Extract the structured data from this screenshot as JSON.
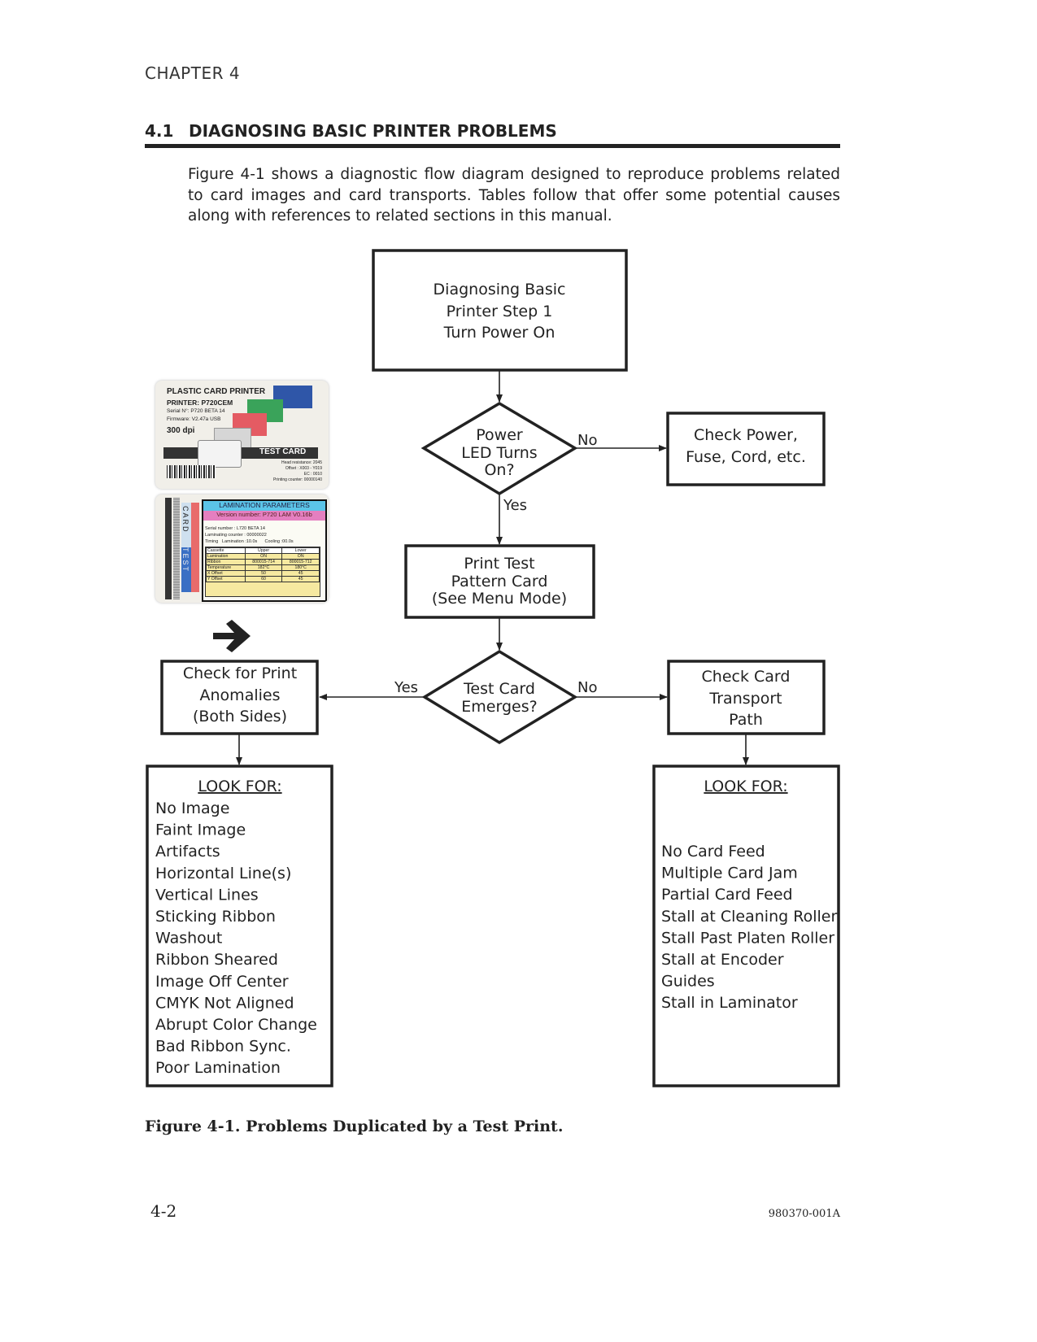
{
  "header": {
    "chapter": "CHAPTER 4"
  },
  "section": {
    "number": "4.1",
    "title": "DIAGNOSING BASIC PRINTER PROBLEMS"
  },
  "intro": "Figure 4-1 shows a diagnostic flow diagram designed to reproduce problems related to card images and card transports. Tables follow that offer some potential causes along with references to related sections in this manual.",
  "flow": {
    "start": [
      "Diagnosing Basic",
      "Printer Step 1",
      "Turn Power On"
    ],
    "decision1": [
      "Power",
      "LED Turns",
      "On?"
    ],
    "decision1_no": "No",
    "decision1_yes": "Yes",
    "check_power": [
      "Check Power,",
      "Fuse, Cord, etc."
    ],
    "print_test": [
      "Print Test",
      "Pattern Card",
      "(See Menu Mode)"
    ],
    "decision2": [
      "Test Card",
      "Emerges?"
    ],
    "decision2_yes": "Yes",
    "decision2_no": "No",
    "check_print": [
      "Check for Print",
      "Anomalies",
      "(Both Sides)"
    ],
    "check_transport": [
      "Check Card",
      "Transport",
      "Path"
    ],
    "look_for_left": {
      "title": "LOOK FOR:",
      "items": [
        "No Image",
        "Faint Image",
        "Artifacts",
        "Horizontal Line(s)",
        "Vertical Lines",
        "Sticking Ribbon",
        "Washout",
        "Ribbon Sheared",
        "Image Off Center",
        "CMYK Not Aligned",
        "Abrupt Color Change",
        "Bad Ribbon Sync.",
        "Poor Lamination"
      ]
    },
    "look_for_right": {
      "title": "LOOK FOR:",
      "items": [
        "No Card Feed",
        "Multiple Card Jam",
        "Partial Card Feed",
        "Stall at Cleaning Roller",
        "Stall Past Platen Roller",
        "Stall at Encoder",
        "Guides",
        "Stall in Laminator"
      ]
    }
  },
  "test_card": {
    "title": "PLASTIC CARD PRINTER",
    "printer": "PRINTER: P720CEM",
    "serial": "Serial N°: P720 BETA 14",
    "firmware": "Firmware: V2.47a USB",
    "dpi": "300 dpi",
    "label": "TEST CARD",
    "head": "Head resistance: 2045",
    "offset": "Offset : X003 - Y019",
    "ec": "EC : 0010",
    "counter": "Printing counter: 00000140"
  },
  "lam_card": {
    "side": "CARD",
    "side2": "TEST",
    "title": "LAMINATION PARAMETERS",
    "version": "Version number: P720 LAM V0.16b",
    "serial": "Serial number : L720 BETA 14",
    "counter": "Laminating counter : 00000022",
    "timing": "Timing   Lamination :10.0s      Cooling :00.0s",
    "table": {
      "headers": [
        "Cassette",
        "Upper",
        "Lower"
      ],
      "rows": [
        [
          "Lamination",
          "ON",
          "ON"
        ],
        [
          "Ribbon",
          "800015-714",
          "800015-712"
        ],
        [
          "Temperature",
          "182°C",
          "180°C"
        ],
        [
          "X Offset",
          "50",
          "45"
        ],
        [
          "Y Offset",
          "60",
          "45"
        ]
      ]
    }
  },
  "caption": "Figure 4-1. Problems Duplicated by a Test Print.",
  "footer": {
    "page": "4-2",
    "doc": "980370-001A"
  }
}
